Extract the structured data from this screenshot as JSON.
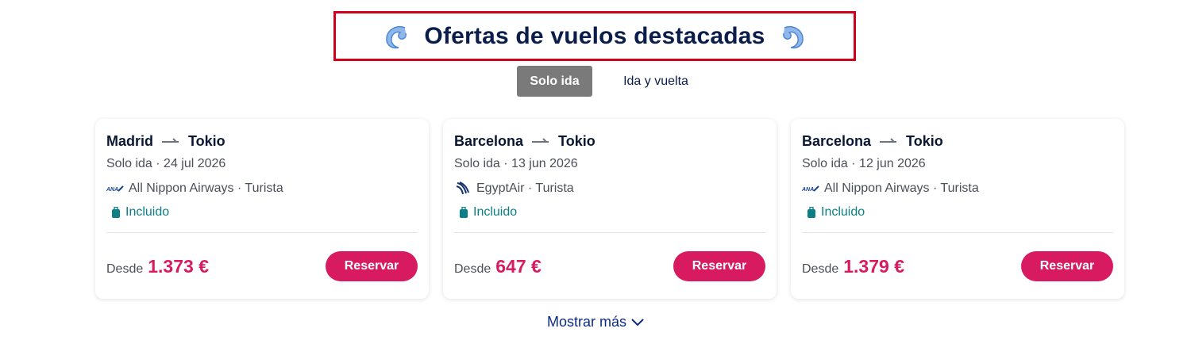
{
  "header": {
    "title": "Ofertas de vuelos destacadas",
    "left_icon": "wave-icon",
    "right_icon": "wave-icon"
  },
  "tabs": [
    {
      "label": "Solo ida",
      "active": true
    },
    {
      "label": "Ida y vuelta",
      "active": false
    }
  ],
  "cards": [
    {
      "origin": "Madrid",
      "destination": "Tokio",
      "meta": "Solo ida · 24 jul 2026",
      "airline": "All Nippon Airways · Turista",
      "airline_logo": "ana-logo-icon",
      "baggage": "Incluido",
      "desde": "Desde",
      "price": "1.373 €",
      "button": "Reservar"
    },
    {
      "origin": "Barcelona",
      "destination": "Tokio",
      "meta": "Solo ida · 13 jun 2026",
      "airline": "EgyptAir · Turista",
      "airline_logo": "egyptair-logo-icon",
      "baggage": "Incluido",
      "desde": "Desde",
      "price": "647 €",
      "button": "Reservar"
    },
    {
      "origin": "Barcelona",
      "destination": "Tokio",
      "meta": "Solo ida · 12 jun 2026",
      "airline": "All Nippon Airways · Turista",
      "airline_logo": "ana-logo-icon",
      "baggage": "Incluido",
      "desde": "Desde",
      "price": "1.379 €",
      "button": "Reservar"
    }
  ],
  "show_more": "Mostrar más",
  "colors": {
    "accent": "#d81b60",
    "title": "#0b1d4a",
    "included": "#0b7f86",
    "highlight_border": "#d0021b",
    "tab_active": "#7a7a7a"
  }
}
